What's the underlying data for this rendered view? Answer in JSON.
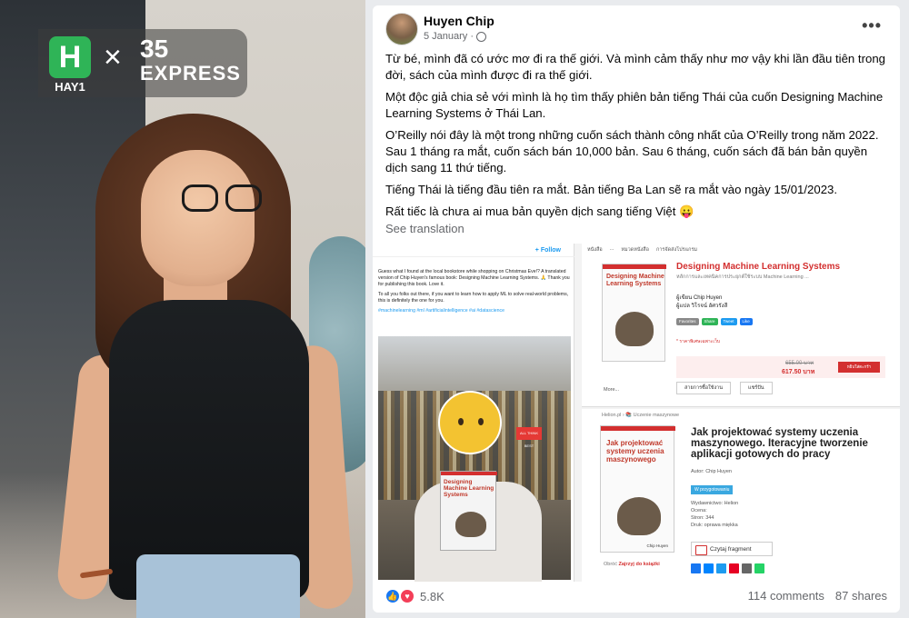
{
  "logo": {
    "brand_letter": "H",
    "brand_name": "HAY1",
    "times": "×",
    "number": "35",
    "word": "EXPRESS"
  },
  "post": {
    "author": "Huyen Chip",
    "date": "5 January",
    "dot": "·",
    "more": "•••",
    "paragraphs": [
      "Từ bé, mình đã có ước mơ đi ra thế giới. Và mình cảm thấy như mơ vậy khi lần đầu tiên trong đời, sách của mình được đi ra thế giới.",
      "Một độc giả chia sẻ với mình là họ tìm thấy phiên bản tiếng Thái của cuốn Designing Machine Learning Systems ở Thái Lan.",
      "O’Reilly nói đây là một trong những cuốn sách thành công nhất của O’Reilly trong năm 2022. Sau 1 tháng ra mắt, cuốn sách bán 10,000 bản. Sau 6 tháng, cuốn sách đã bán bản quyền dịch sang 11 thứ tiếng.",
      "Tiếng Thái là tiếng đầu tiên ra mắt. Bản tiếng Ba Lan sẽ ra mắt vào ngày 15/01/2023.",
      "Rất tiếc là chưa ai mua bản quyền dịch sang tiếng Việt 😛"
    ],
    "see_translation": "See translation"
  },
  "tweet": {
    "follow": "+ Follow",
    "text1": "Guess what I found at the local bookstore while shopping on Christmas Eve!? A translated version of Chip Huyen's famous book: Designing Machine Learning Systems. 🙏 Thank you for publishing this book. Love it.",
    "text2": "To all you folks out there, if you want to learn how to apply ML to solve real-world problems, this is definitely the one for you.",
    "tags": "#machinelearning #ml #artificialintelligence #ai #datascience",
    "book_title": "Designing Machine Learning Systems",
    "button": "ALL THINK BEST"
  },
  "thai_store": {
    "tabs": [
      "หนังสือ",
      "...",
      "หมวดหนังสือ",
      "การจัดส่งโปรแกรม"
    ],
    "cover_title": "Designing Machine Learning Systems",
    "title": "Designing Machine Learning Systems",
    "subtitle": "หลักการและเทคนิคการประยุกต์ใช้ระบบ Machine Learning ...",
    "author_line": "ผู้เขียน  Chip Huyen",
    "translator_line": "ผู้แปล  วิโรจน์ อัศวรังสี",
    "share_buttons": [
      "Favorites",
      "Share",
      "Tweet",
      "Like"
    ],
    "note": "* ราคาพิเศษเฉพาะเว็บ",
    "old_price": "655.00 บาท",
    "new_price": "617.50 บาท",
    "buy": "หยิบใส่ตะกร้า",
    "wish_items": [
      "สายการซื้อใช้งาน",
      "แชร์ปัน"
    ],
    "more": "More..."
  },
  "polish_store": {
    "crumb": "Helion.pl › 📚 Uczenie maszynowe",
    "cover_title": "Jak projektować systemy uczenia maszynowego",
    "cover_author": "Chip Huyen",
    "title": "Jak projektować systemy uczenia maszynowego. Iteracyjne tworzenie aplikacji gotowych do pracy",
    "author": "Autor: Chip Huyen",
    "tag": "W przygotowaniu",
    "publisher": "Wydawnictwo: Helion",
    "rating": "Ocena:",
    "pages": "Stron: 344",
    "binding": "Druk: oprawa miękka",
    "read_fragment": "Czytaj fragment",
    "look_prefix": "Obróć",
    "look_link": "Zajrzyj do książki"
  },
  "footer": {
    "reaction_count": "5.8K",
    "comments": "114 comments",
    "shares": "87 shares"
  },
  "colors": {
    "facebook_blue": "#1877f2",
    "love_red": "#f33e58",
    "brand_green": "#2fb457",
    "orelly_red": "#d32f2f"
  }
}
